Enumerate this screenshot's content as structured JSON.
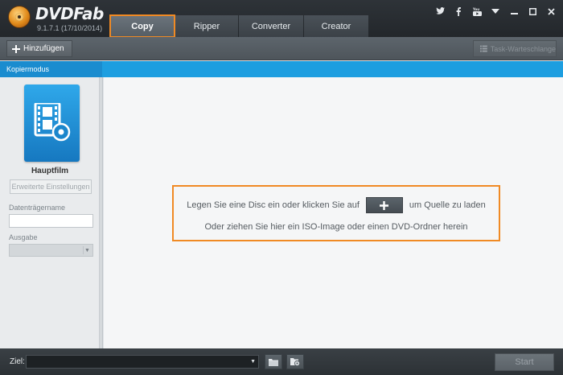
{
  "app": {
    "logo_text": "DVDFab",
    "version": "9.1.7.1 (17/10/2014)"
  },
  "tabs": [
    {
      "label": "Copy",
      "active": true
    },
    {
      "label": "Ripper",
      "active": false
    },
    {
      "label": "Converter",
      "active": false
    },
    {
      "label": "Creator",
      "active": false
    }
  ],
  "window_controls": [
    "twitter-icon",
    "facebook-icon",
    "youtube-icon",
    "dropdown-icon",
    "minimize-icon",
    "maximize-icon",
    "close-icon"
  ],
  "toolbar": {
    "add_label": "Hinzufügen",
    "queue_label": "Task-Warteschlange"
  },
  "mode_bar": {
    "label": "Kopiermodus"
  },
  "left_panel": {
    "mode_name": "Hauptfilm",
    "advanced_settings_label": "Erweiterte Einstellungen",
    "volume_label": "Datenträgername",
    "volume_value": "",
    "output_label": "Ausgabe",
    "output_value": ""
  },
  "main": {
    "drop_line1_before": "Legen Sie eine Disc ein oder klicken Sie auf",
    "drop_line1_after": "um Quelle zu laden",
    "drop_line2": "Oder ziehen Sie hier ein ISO-Image oder einen DVD-Ordner herein"
  },
  "bottom": {
    "target_label": "Ziel:",
    "target_value": "",
    "start_label": "Start"
  },
  "colors": {
    "accent_orange": "#f08a24",
    "mode_bar_blue": "#1d9ee0",
    "tile_blue": "#1f8fd6"
  }
}
